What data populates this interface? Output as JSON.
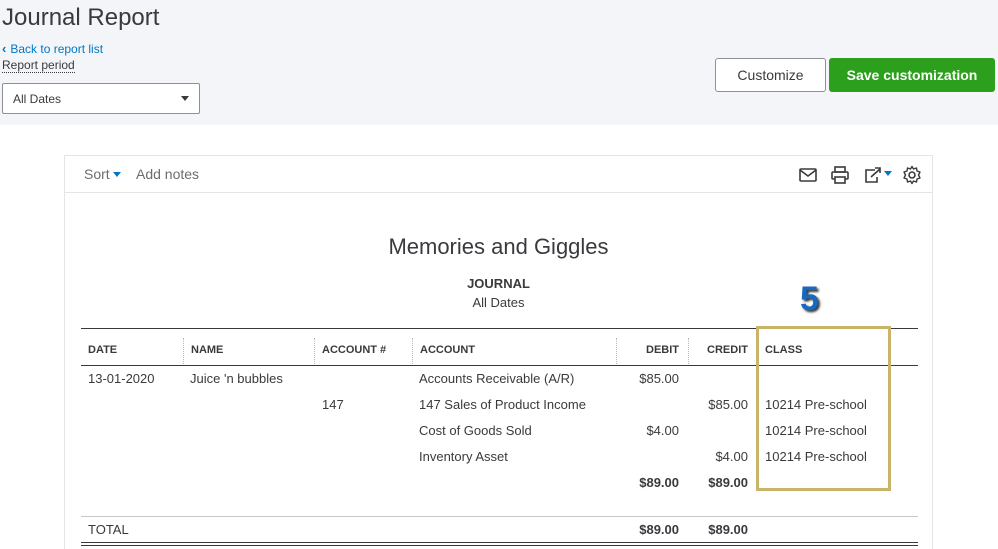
{
  "header": {
    "title": "Journal Report",
    "back_link": "Back to report list",
    "period_label": "Report period",
    "period_value": "All Dates",
    "customize_label": "Customize",
    "save_label": "Save customization"
  },
  "toolbar": {
    "sort_label": "Sort",
    "add_notes_label": "Add notes",
    "icons": [
      "email-icon",
      "print-icon",
      "export-icon",
      "settings-icon"
    ]
  },
  "report": {
    "company": "Memories and Giggles",
    "title": "JOURNAL",
    "dates": "All Dates",
    "annotation": "5",
    "columns": [
      "DATE",
      "NAME",
      "ACCOUNT #",
      "ACCOUNT",
      "DEBIT",
      "CREDIT",
      "CLASS"
    ],
    "rows": [
      {
        "date": "13-01-2020",
        "name": "Juice 'n bubbles",
        "account_num": "",
        "account": "Accounts Receivable (A/R)",
        "debit": "$85.00",
        "credit": "",
        "class": ""
      },
      {
        "date": "",
        "name": "",
        "account_num": "147",
        "account": "147 Sales of Product Income",
        "debit": "",
        "credit": "$85.00",
        "class": "10214 Pre-school"
      },
      {
        "date": "",
        "name": "",
        "account_num": "",
        "account": "Cost of Goods Sold",
        "debit": "$4.00",
        "credit": "",
        "class": "10214 Pre-school"
      },
      {
        "date": "",
        "name": "",
        "account_num": "",
        "account": "Inventory Asset",
        "debit": "",
        "credit": "$4.00",
        "class": "10214 Pre-school"
      }
    ],
    "subtotal": {
      "debit": "$89.00",
      "credit": "$89.00"
    },
    "total": {
      "label": "TOTAL",
      "debit": "$89.00",
      "credit": "$89.00"
    }
  },
  "colors": {
    "primary_green": "#2ca01c",
    "link_blue": "#0077c5",
    "highlight": "#c9b46a"
  }
}
